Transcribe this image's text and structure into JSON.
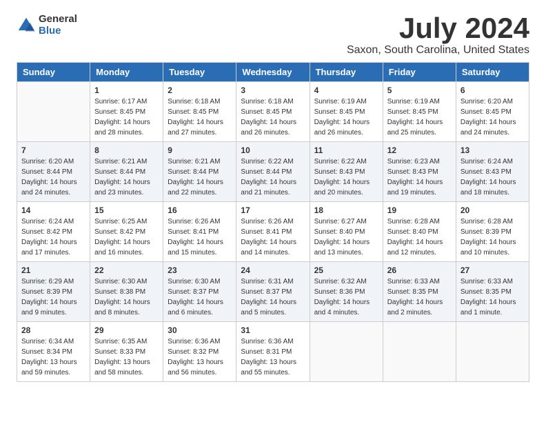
{
  "logo": {
    "general": "General",
    "blue": "Blue"
  },
  "title": "July 2024",
  "subtitle": "Saxon, South Carolina, United States",
  "days_header": [
    "Sunday",
    "Monday",
    "Tuesday",
    "Wednesday",
    "Thursday",
    "Friday",
    "Saturday"
  ],
  "weeks": [
    [
      {
        "day": "",
        "info": ""
      },
      {
        "day": "1",
        "info": "Sunrise: 6:17 AM\nSunset: 8:45 PM\nDaylight: 14 hours and 28 minutes."
      },
      {
        "day": "2",
        "info": "Sunrise: 6:18 AM\nSunset: 8:45 PM\nDaylight: 14 hours and 27 minutes."
      },
      {
        "day": "3",
        "info": "Sunrise: 6:18 AM\nSunset: 8:45 PM\nDaylight: 14 hours and 26 minutes."
      },
      {
        "day": "4",
        "info": "Sunrise: 6:19 AM\nSunset: 8:45 PM\nDaylight: 14 hours and 26 minutes."
      },
      {
        "day": "5",
        "info": "Sunrise: 6:19 AM\nSunset: 8:45 PM\nDaylight: 14 hours and 25 minutes."
      },
      {
        "day": "6",
        "info": "Sunrise: 6:20 AM\nSunset: 8:45 PM\nDaylight: 14 hours and 24 minutes."
      }
    ],
    [
      {
        "day": "7",
        "info": "Sunrise: 6:20 AM\nSunset: 8:44 PM\nDaylight: 14 hours and 24 minutes."
      },
      {
        "day": "8",
        "info": "Sunrise: 6:21 AM\nSunset: 8:44 PM\nDaylight: 14 hours and 23 minutes."
      },
      {
        "day": "9",
        "info": "Sunrise: 6:21 AM\nSunset: 8:44 PM\nDaylight: 14 hours and 22 minutes."
      },
      {
        "day": "10",
        "info": "Sunrise: 6:22 AM\nSunset: 8:44 PM\nDaylight: 14 hours and 21 minutes."
      },
      {
        "day": "11",
        "info": "Sunrise: 6:22 AM\nSunset: 8:43 PM\nDaylight: 14 hours and 20 minutes."
      },
      {
        "day": "12",
        "info": "Sunrise: 6:23 AM\nSunset: 8:43 PM\nDaylight: 14 hours and 19 minutes."
      },
      {
        "day": "13",
        "info": "Sunrise: 6:24 AM\nSunset: 8:43 PM\nDaylight: 14 hours and 18 minutes."
      }
    ],
    [
      {
        "day": "14",
        "info": "Sunrise: 6:24 AM\nSunset: 8:42 PM\nDaylight: 14 hours and 17 minutes."
      },
      {
        "day": "15",
        "info": "Sunrise: 6:25 AM\nSunset: 8:42 PM\nDaylight: 14 hours and 16 minutes."
      },
      {
        "day": "16",
        "info": "Sunrise: 6:26 AM\nSunset: 8:41 PM\nDaylight: 14 hours and 15 minutes."
      },
      {
        "day": "17",
        "info": "Sunrise: 6:26 AM\nSunset: 8:41 PM\nDaylight: 14 hours and 14 minutes."
      },
      {
        "day": "18",
        "info": "Sunrise: 6:27 AM\nSunset: 8:40 PM\nDaylight: 14 hours and 13 minutes."
      },
      {
        "day": "19",
        "info": "Sunrise: 6:28 AM\nSunset: 8:40 PM\nDaylight: 14 hours and 12 minutes."
      },
      {
        "day": "20",
        "info": "Sunrise: 6:28 AM\nSunset: 8:39 PM\nDaylight: 14 hours and 10 minutes."
      }
    ],
    [
      {
        "day": "21",
        "info": "Sunrise: 6:29 AM\nSunset: 8:39 PM\nDaylight: 14 hours and 9 minutes."
      },
      {
        "day": "22",
        "info": "Sunrise: 6:30 AM\nSunset: 8:38 PM\nDaylight: 14 hours and 8 minutes."
      },
      {
        "day": "23",
        "info": "Sunrise: 6:30 AM\nSunset: 8:37 PM\nDaylight: 14 hours and 6 minutes."
      },
      {
        "day": "24",
        "info": "Sunrise: 6:31 AM\nSunset: 8:37 PM\nDaylight: 14 hours and 5 minutes."
      },
      {
        "day": "25",
        "info": "Sunrise: 6:32 AM\nSunset: 8:36 PM\nDaylight: 14 hours and 4 minutes."
      },
      {
        "day": "26",
        "info": "Sunrise: 6:33 AM\nSunset: 8:35 PM\nDaylight: 14 hours and 2 minutes."
      },
      {
        "day": "27",
        "info": "Sunrise: 6:33 AM\nSunset: 8:35 PM\nDaylight: 14 hours and 1 minute."
      }
    ],
    [
      {
        "day": "28",
        "info": "Sunrise: 6:34 AM\nSunset: 8:34 PM\nDaylight: 13 hours and 59 minutes."
      },
      {
        "day": "29",
        "info": "Sunrise: 6:35 AM\nSunset: 8:33 PM\nDaylight: 13 hours and 58 minutes."
      },
      {
        "day": "30",
        "info": "Sunrise: 6:36 AM\nSunset: 8:32 PM\nDaylight: 13 hours and 56 minutes."
      },
      {
        "day": "31",
        "info": "Sunrise: 6:36 AM\nSunset: 8:31 PM\nDaylight: 13 hours and 55 minutes."
      },
      {
        "day": "",
        "info": ""
      },
      {
        "day": "",
        "info": ""
      },
      {
        "day": "",
        "info": ""
      }
    ]
  ]
}
